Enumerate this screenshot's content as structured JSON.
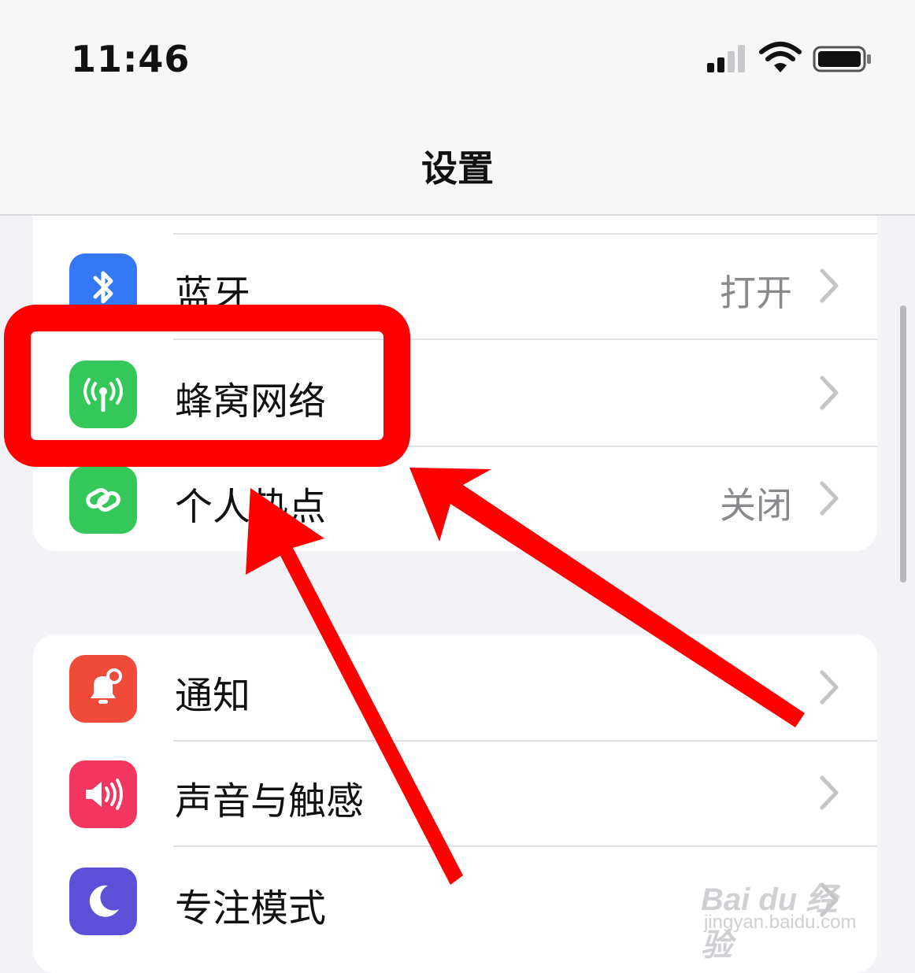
{
  "status_bar": {
    "time": "11:46"
  },
  "nav": {
    "title": "设置"
  },
  "settings": {
    "bluetooth": {
      "label": "蓝牙",
      "value": "打开",
      "icon": "bluetooth-icon",
      "color": "#3478f6"
    },
    "cellular": {
      "label": "蜂窝网络",
      "icon": "antenna-icon",
      "color": "#34c759"
    },
    "hotspot": {
      "label": "个人热点",
      "value": "关闭",
      "icon": "link-icon",
      "color": "#34c759"
    },
    "notifications": {
      "label": "通知",
      "icon": "bell-icon",
      "color": "#f04a3a"
    },
    "sounds": {
      "label": "声音与触感",
      "icon": "speaker-icon",
      "color": "#f2365f"
    },
    "focus": {
      "label": "专注模式",
      "icon": "moon-icon",
      "color": "#5e4fd8"
    }
  },
  "annotation": {
    "highlight_color": "#ff0000"
  },
  "watermark": {
    "brand": "Bai du 经验",
    "url": "jingyan.baidu.com"
  }
}
